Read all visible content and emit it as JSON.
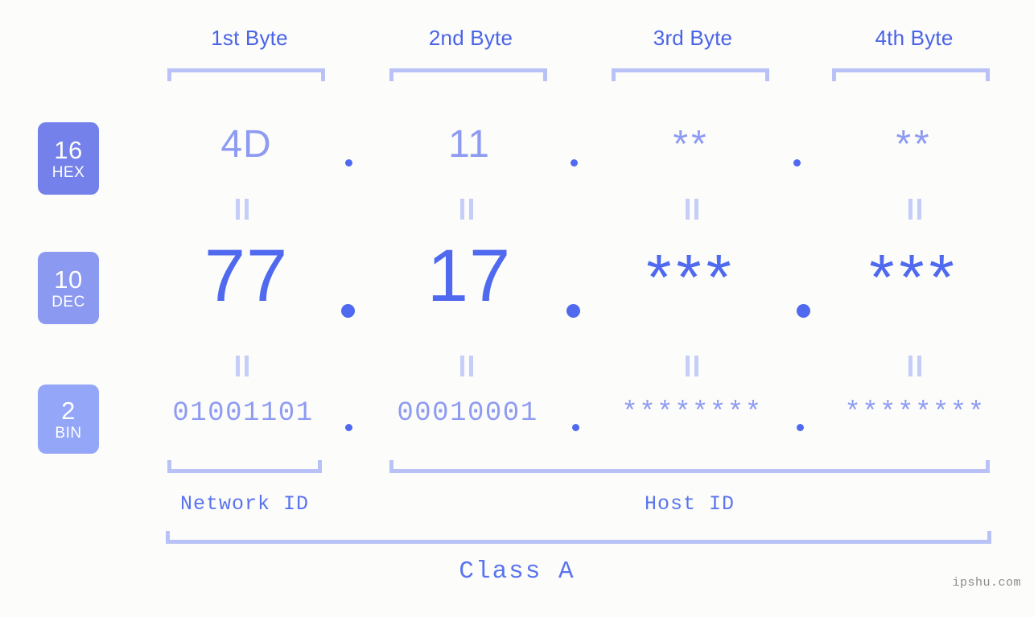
{
  "page": {
    "background_color": "#fcfdfa",
    "watermark": "ipshu.com",
    "class_label": "Class A"
  },
  "colors": {
    "header_blue": "#4a63e7",
    "bracket_lavender": "#b9c2f7",
    "hex_value": "#8e9bf2",
    "dec_value": "#4f69ef",
    "bin_value": "#8e9bf2",
    "badge_hex": "#7481ea",
    "badge_dec": "#8c99f0",
    "badge_bin": "#93a6f7",
    "id_label": "#5a73ef",
    "watermark": "#8b8b8b"
  },
  "byte_headers": [
    {
      "label": "1st Byte"
    },
    {
      "label": "2nd Byte"
    },
    {
      "label": "3rd Byte"
    },
    {
      "label": "4th Byte"
    }
  ],
  "bases": [
    {
      "number": "16",
      "name": "HEX"
    },
    {
      "number": "10",
      "name": "DEC"
    },
    {
      "number": "2",
      "name": "BIN"
    }
  ],
  "rows": {
    "hex": {
      "base_number": "16",
      "base_name": "HEX",
      "values": [
        "4D",
        "11",
        "**",
        "**"
      ],
      "separator": "."
    },
    "dec": {
      "base_number": "10",
      "base_name": "DEC",
      "values": [
        "77",
        "17",
        "***",
        "***"
      ],
      "separator": "."
    },
    "bin": {
      "base_number": "2",
      "base_name": "BIN",
      "values": [
        "01001101",
        "00010001",
        "********",
        "********"
      ],
      "separator": "."
    }
  },
  "equals_marks": {
    "glyph": "=",
    "count_per_row": 4,
    "rows": 2
  },
  "id_sections": [
    {
      "label": "Network ID",
      "span_bytes": 1
    },
    {
      "label": "Host ID",
      "span_bytes": 3
    }
  ]
}
